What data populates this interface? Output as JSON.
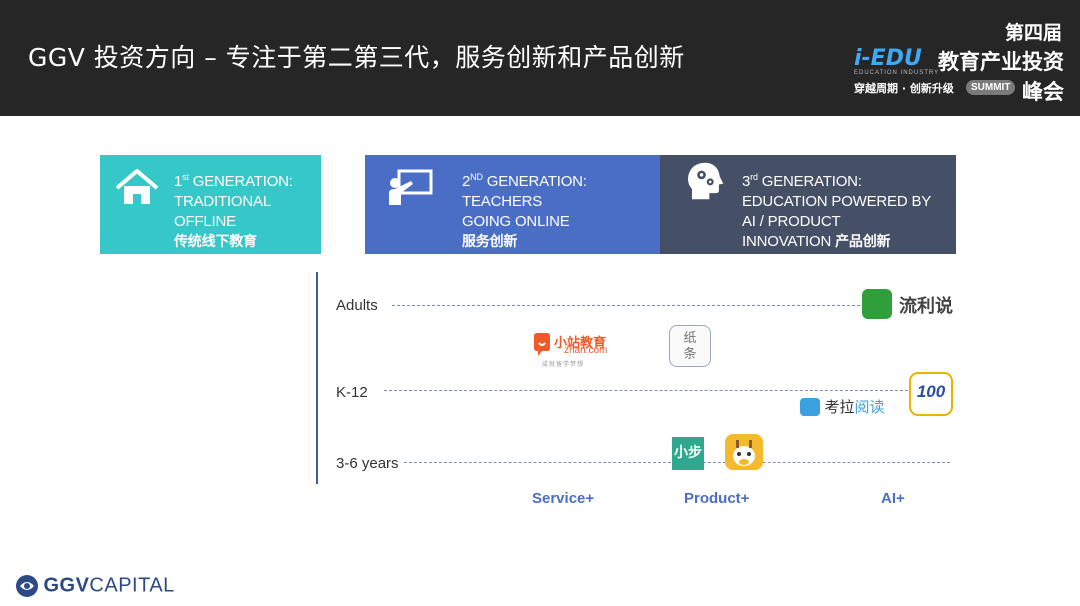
{
  "header": {
    "title": "GGV 投资方向 – 专注于第二第三代，服务创新和产品创新",
    "event_logo": {
      "edition": "第四届",
      "brand": "i-EDU",
      "name": "教育产业投资",
      "sub": "EDUCATION INDUSTRY",
      "slogan": "穿越周期 · 创新升级",
      "pill": "SUMMIT",
      "suffix": "峰会"
    }
  },
  "generations": [
    {
      "icon": "house-icon",
      "num": "1",
      "sup": "st",
      "line1_rest": " GENERATION:",
      "line2": "TRADITIONAL",
      "line3": "OFFLINE",
      "cn": "传统线下教育",
      "color": "#36c7c9"
    },
    {
      "icon": "teacher-board-icon",
      "num": "2",
      "sup": "ND",
      "line1_rest": " GENERATION:",
      "line2": "TEACHERS",
      "line3": "GOING ONLINE",
      "cn": "服务创新",
      "color": "#4a6ec6"
    },
    {
      "icon": "head-gears-icon",
      "num": "3",
      "sup": "rd",
      "line1_rest": " GENERATION:",
      "line2": "EDUCATION POWERED BY",
      "line3": "AI / PRODUCT",
      "line4_en": "INNOVATION ",
      "cn": "产品创新",
      "color": "#455066"
    }
  ],
  "rows": [
    {
      "label": "Adults"
    },
    {
      "label": "K-12"
    },
    {
      "label": "3-6 years"
    }
  ],
  "columns": [
    {
      "label": "Service+"
    },
    {
      "label": "Product+"
    },
    {
      "label": "AI+"
    }
  ],
  "companies": {
    "liulishuo": "流利说",
    "xiaozhan_name": "小站教育",
    "xiaozhan_url": "zhan.com",
    "xiaozhan_slogan": "成就留学梦想",
    "zhitiao": "纸\n条",
    "yiqi": "100",
    "kaola_a": "考拉",
    "kaola_b": "阅读",
    "xiaobu": "小步"
  },
  "footer": {
    "brand_bold": "GGV",
    "brand_light": "CAPITAL"
  },
  "colors": {
    "teal": "#36c7c9",
    "blue": "#4a6ec6",
    "slate": "#455066",
    "header": "#262626"
  }
}
